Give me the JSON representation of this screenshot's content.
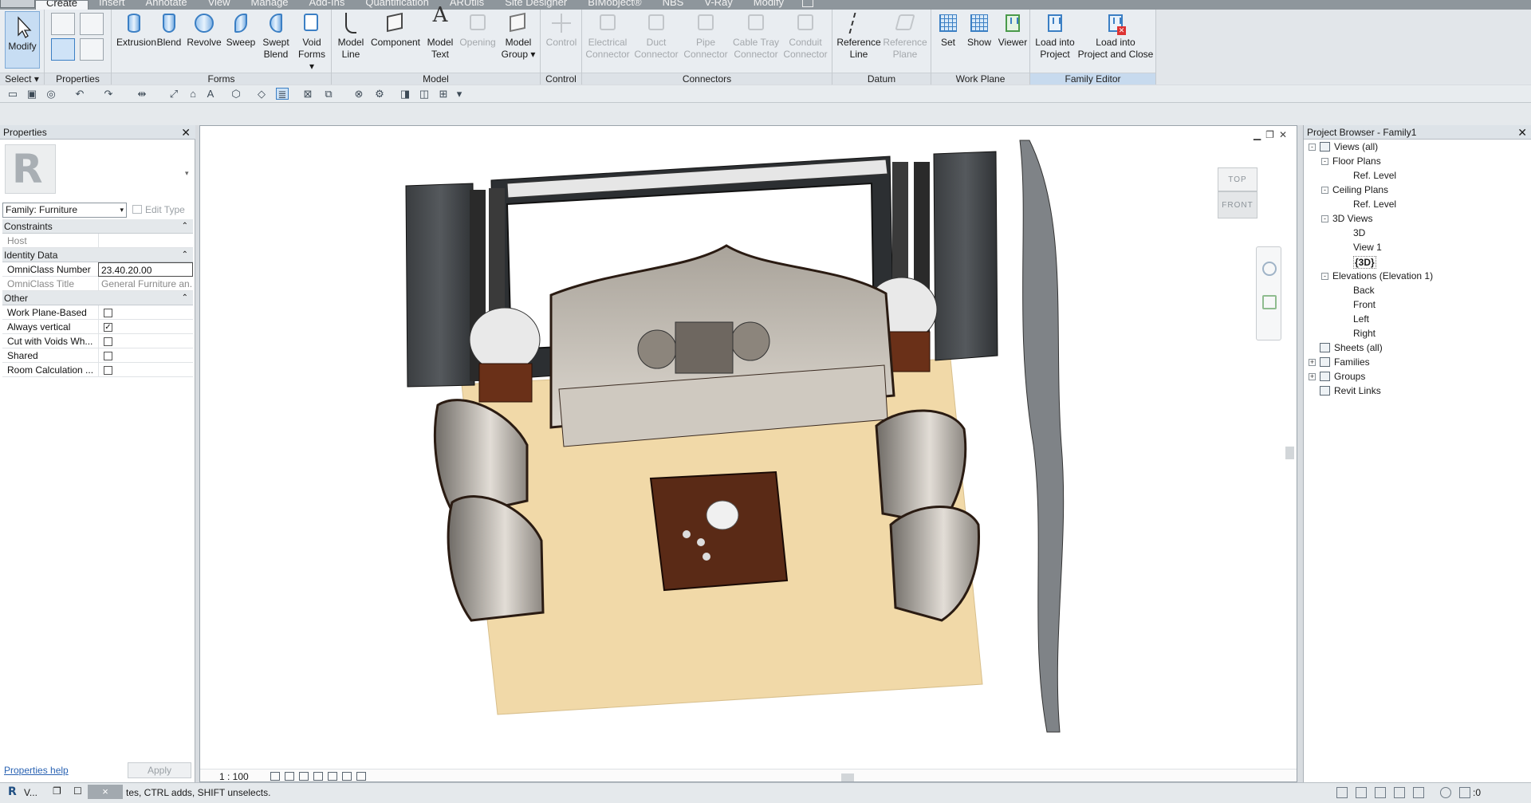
{
  "ribbon": {
    "tabs": [
      "Create",
      "Insert",
      "Annotate",
      "View",
      "Manage",
      "Add-Ins",
      "Quantification",
      "ARUtils",
      "Site Designer",
      "BIMobject®",
      "NBS",
      "V-Ray",
      "Modify"
    ],
    "active_tab": "Create",
    "buttons": {
      "modify": "Modify",
      "extrusion": "Extrusion",
      "blend": "Blend",
      "revolve": "Revolve",
      "sweep": "Sweep",
      "swept_blend_1": "Swept",
      "swept_blend_2": "Blend",
      "void_forms_1": "Void",
      "void_forms_2": "Forms",
      "model_line_1": "Model",
      "model_line_2": "Line",
      "component": "Component",
      "model_text_1": "Model",
      "model_text_2": "Text",
      "opening": "Opening",
      "model_group_1": "Model",
      "model_group_2": "Group",
      "control": "Control",
      "electrical_1": "Electrical",
      "electrical_2": "Connector",
      "duct_1": "Duct",
      "duct_2": "Connector",
      "pipe_1": "Pipe",
      "pipe_2": "Connector",
      "cable_1": "Cable Tray",
      "cable_2": "Connector",
      "conduit_1": "Conduit",
      "conduit_2": "Connector",
      "ref_line_1": "Reference",
      "ref_line_2": "Line",
      "ref_plane_1": "Reference",
      "ref_plane_2": "Plane",
      "set": "Set",
      "show": "Show",
      "viewer": "Viewer",
      "load_project_1": "Load into",
      "load_project_2": "Project",
      "load_close_1": "Load into",
      "load_close_2": "Project and Close"
    },
    "panels": {
      "select": "Select",
      "properties": "Properties",
      "forms": "Forms",
      "model": "Model",
      "control": "Control",
      "connectors": "Connectors",
      "datum": "Datum",
      "work_plane": "Work Plane",
      "family_editor": "Family Editor"
    }
  },
  "properties": {
    "title": "Properties",
    "type_logo": "R",
    "family_select": "Family: Furniture",
    "edit_type": "Edit Type",
    "groups": {
      "constraints": "Constraints",
      "identity": "Identity Data",
      "other": "Other"
    },
    "rows": {
      "host": "Host",
      "omniclass_number_label": "OmniClass Number",
      "omniclass_number_value": "23.40.20.00",
      "omniclass_title_label": "OmniClass Title",
      "omniclass_title_value": "General Furniture an...",
      "work_plane_based": "Work Plane-Based",
      "always_vertical": "Always vertical",
      "cut_with_voids": "Cut with Voids Wh...",
      "shared": "Shared",
      "room_calculation": "Room Calculation ..."
    },
    "checkboxes": {
      "work_plane_based": false,
      "always_vertical": true,
      "cut_with_voids": false,
      "shared": false,
      "room_calculation": false
    },
    "help_link": "Properties help",
    "apply": "Apply"
  },
  "viewport": {
    "scale": "1 : 100",
    "viewcube_top": "TOP",
    "viewcube_front": "FRONT"
  },
  "browser": {
    "title": "Project Browser - Family1",
    "tree": [
      {
        "label": "Views (all)",
        "level": 0,
        "toggle": "-",
        "icon": true
      },
      {
        "label": "Floor Plans",
        "level": 1,
        "toggle": "-"
      },
      {
        "label": "Ref. Level",
        "level": 2
      },
      {
        "label": "Ceiling Plans",
        "level": 1,
        "toggle": "-"
      },
      {
        "label": "Ref. Level",
        "level": 2
      },
      {
        "label": "3D Views",
        "level": 1,
        "toggle": "-"
      },
      {
        "label": "3D",
        "level": 2
      },
      {
        "label": "View 1",
        "level": 2
      },
      {
        "label": "{3D}",
        "level": 2,
        "bold": true
      },
      {
        "label": "Elevations (Elevation 1)",
        "level": 1,
        "toggle": "-"
      },
      {
        "label": "Back",
        "level": 2
      },
      {
        "label": "Front",
        "level": 2
      },
      {
        "label": "Left",
        "level": 2
      },
      {
        "label": "Right",
        "level": 2
      },
      {
        "label": "Sheets (all)",
        "level": 0,
        "icon": true
      },
      {
        "label": "Families",
        "level": 0,
        "toggle": "+",
        "icon": true
      },
      {
        "label": "Groups",
        "level": 0,
        "toggle": "+",
        "icon": true
      },
      {
        "label": "Revit Links",
        "level": 0,
        "icon": true
      }
    ]
  },
  "status": {
    "task_label": "V...",
    "task_close": "×",
    "text": "tes, CTRL adds, SHIFT unselects.",
    "filter_count": ":0"
  },
  "colors": {
    "accent": "#3b7fc4",
    "rug": "#f1d9a8",
    "wood": "#5a2a16"
  }
}
